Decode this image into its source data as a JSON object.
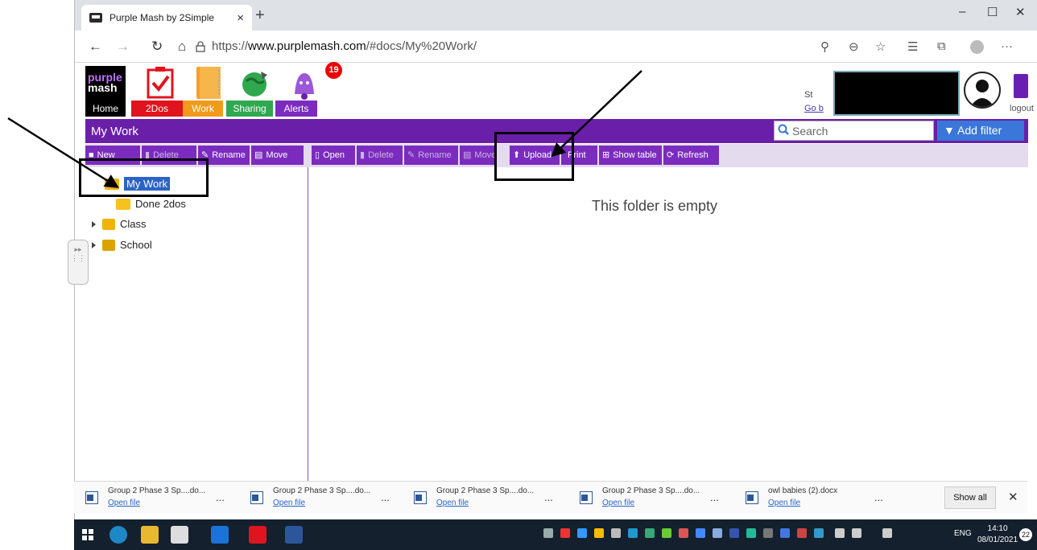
{
  "browser": {
    "tab_title": "Purple Mash by 2Simple",
    "tab_close": "×",
    "new_tab": "+",
    "url_prefix": "https://",
    "url_host": "www.purplemash.com",
    "url_path": "/#docs/My%20Work/",
    "minimize": "–",
    "maximize": "☐",
    "close": "✕",
    "back": "←",
    "forward": "→",
    "refresh": "↻",
    "home": "⌂",
    "more": "···"
  },
  "topnav": {
    "logo_line1": "purple",
    "logo_line2": "mash",
    "items": [
      {
        "label": "Home",
        "color": "#000000"
      },
      {
        "label": "2Dos",
        "color": "#e0141e"
      },
      {
        "label": "Work",
        "color": "#f29a1c"
      },
      {
        "label": "Sharing",
        "color": "#2fa84f"
      },
      {
        "label": "Alerts",
        "color": "#7b2cbf"
      }
    ],
    "alerts_count": "19",
    "user_st": "St",
    "user_go": "Go b",
    "logout": "logout"
  },
  "header": {
    "title": "My Work",
    "search_placeholder": "Search",
    "add_filter": "Add filter"
  },
  "folder_toolbar": {
    "new": "New",
    "delete": "Delete",
    "rename": "Rename",
    "move": "Move"
  },
  "file_toolbar": {
    "open": "Open",
    "delete": "Delete",
    "rename": "Rename",
    "move": "Move",
    "upload": "Upload",
    "print": "Print",
    "show_table": "Show table",
    "refresh": "Refresh"
  },
  "tree": [
    {
      "label": "My Work",
      "selected": true
    },
    {
      "label": "Done 2dos"
    },
    {
      "label": "Class"
    },
    {
      "label": "School"
    }
  ],
  "main": {
    "empty_message": "This folder is empty"
  },
  "downloads": {
    "items": [
      {
        "name": "Group 2 Phase 3 Sp....do...",
        "action": "Open file"
      },
      {
        "name": "Group 2 Phase 3 Sp....do...",
        "action": "Open file"
      },
      {
        "name": "Group 2 Phase 3 Sp....do...",
        "action": "Open file"
      },
      {
        "name": "Group 2 Phase 3 Sp....do...",
        "action": "Open file"
      },
      {
        "name": "owl babies (2).docx",
        "action": "Open file"
      }
    ],
    "more": "...",
    "show_all": "Show all",
    "close": "✕"
  },
  "taskbar": {
    "lang": "ENG",
    "time": "14:10",
    "date": "08/01/2021",
    "notif": "22"
  },
  "colors": {
    "purple": "#6a1fa8",
    "button_purple": "#7b2cbf",
    "toolbar_bg": "#e4dbef",
    "filter_blue": "#3a77d8",
    "selection_blue": "#2b63c9"
  }
}
